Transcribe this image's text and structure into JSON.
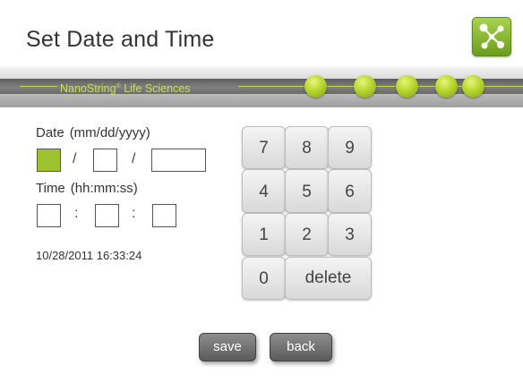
{
  "header": {
    "title": "Set Date and Time",
    "logo_icon": "network-nodes-icon"
  },
  "banner": {
    "brand": "NanoString",
    "brand_mark": "®",
    "brand_suffix": "Life Sciences",
    "accent": "#b7d62f"
  },
  "date": {
    "label": "Date",
    "format": "(mm/dd/yyyy)",
    "separator": "/",
    "month": "",
    "day": "",
    "year": ""
  },
  "time": {
    "label": "Time",
    "format": "(hh:mm:ss)",
    "separator": ":",
    "hours": "",
    "minutes": "",
    "seconds": ""
  },
  "current_datetime": "10/28/2011 16:33:24",
  "keypad": {
    "keys": [
      "7",
      "8",
      "9",
      "4",
      "5",
      "6",
      "1",
      "2",
      "3",
      "0"
    ],
    "delete_label": "delete"
  },
  "actions": {
    "save_label": "save",
    "back_label": "back"
  }
}
